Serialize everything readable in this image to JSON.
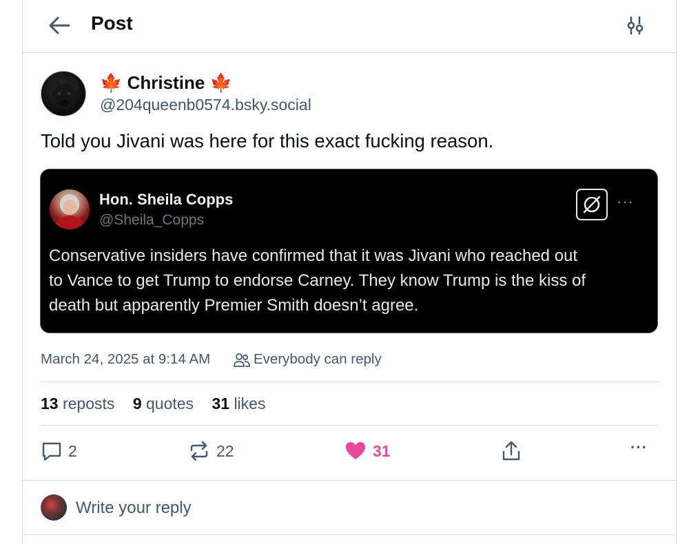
{
  "header": {
    "title": "Post",
    "back_icon": "arrow-left-icon",
    "settings_icon": "sliders-icon"
  },
  "post": {
    "author": {
      "display_name": "🍁 Christine 🍁",
      "handle": "@204queenb0574.bsky.social"
    },
    "text": "Told you Jivani was here for this exact fucking reason.",
    "quote": {
      "name": "Hon. Sheila Copps",
      "handle": "@Sheila_Copps",
      "lines": [
        "Conservative insiders have confirmed that it was Jivani who reached out",
        "to Vance to get Trump to endorse Carney. They know Trump is the kiss of",
        "death but apparently Premier Smith doesn’t agree."
      ],
      "more": "···"
    },
    "timestamp": "March 24, 2025 at 9:14 AM",
    "reply_setting": "Everybody can reply"
  },
  "stats": {
    "reposts_count": "13",
    "reposts_label": "reposts",
    "quotes_count": "9",
    "quotes_label": "quotes",
    "likes_count": "31",
    "likes_label": "likes"
  },
  "actions": {
    "reply_count": "2",
    "repost_count": "22",
    "like_count": "31",
    "more": "···"
  },
  "reply_bar": {
    "placeholder": "Write your reply"
  },
  "colors": {
    "text_primary": "#0b0f14",
    "text_secondary": "#42576c",
    "like_pink": "#ec4899",
    "border": "#d4dbe2",
    "quote_bg": "#000000"
  }
}
